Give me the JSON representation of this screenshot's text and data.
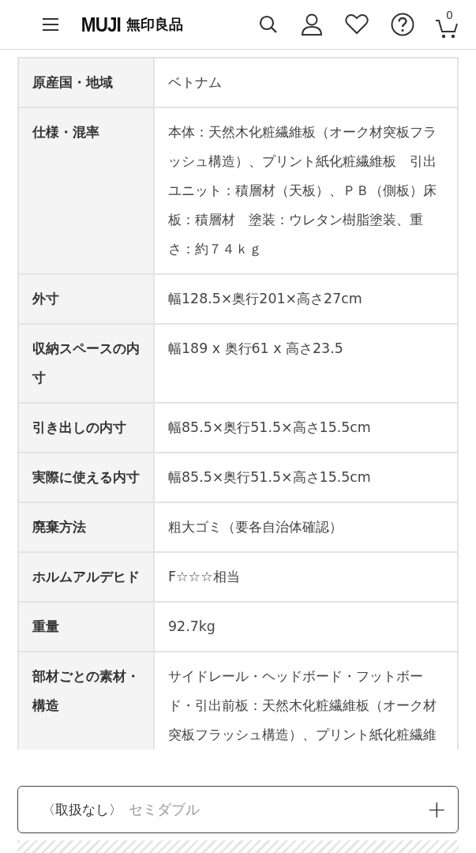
{
  "header": {
    "logo_latin": "MUJI",
    "logo_japanese": "無印良品",
    "cart_count": "0"
  },
  "spec_rows": [
    {
      "label": "原産国・地域",
      "value": "ベトナム"
    },
    {
      "label": "仕様・混率",
      "value": "本体：天然木化粧繊維板（オーク材突板フラッシュ構造）、プリント紙化粧繊維板　引出ユニット：積層材（天板）、ＰＢ（側板）床板：積層材　塗装：ウレタン樹脂塗装、重さ：約７４ｋｇ"
    },
    {
      "label": "外寸",
      "value": "幅128.5×奥行201×高さ27cm"
    },
    {
      "label": "収納スペースの内寸",
      "value": "幅189 x 奥行61 x 高さ23.5"
    },
    {
      "label": "引き出しの内寸",
      "value": "幅85.5×奥行51.5×高さ15.5cm"
    },
    {
      "label": "実際に使える内寸",
      "value": "幅85.5×奥行51.5×高さ15.5cm"
    },
    {
      "label": "廃棄方法",
      "value": "粗大ゴミ（要各自治体確認）"
    },
    {
      "label": "ホルムアルデヒド",
      "value": "F☆☆☆相当"
    },
    {
      "label": "重量",
      "value": "92.7kg"
    },
    {
      "label": "部材ごとの素材・構造",
      "value": "サイドレール・ヘッドボード・フットボード・引出前板：天然木化粧繊維板（オーク材突板フラッシュ構造）、プリント紙化粧繊維"
    }
  ],
  "option_bar": {
    "status": "〈取扱なし〉",
    "size": "セミダブル",
    "button": "+"
  }
}
